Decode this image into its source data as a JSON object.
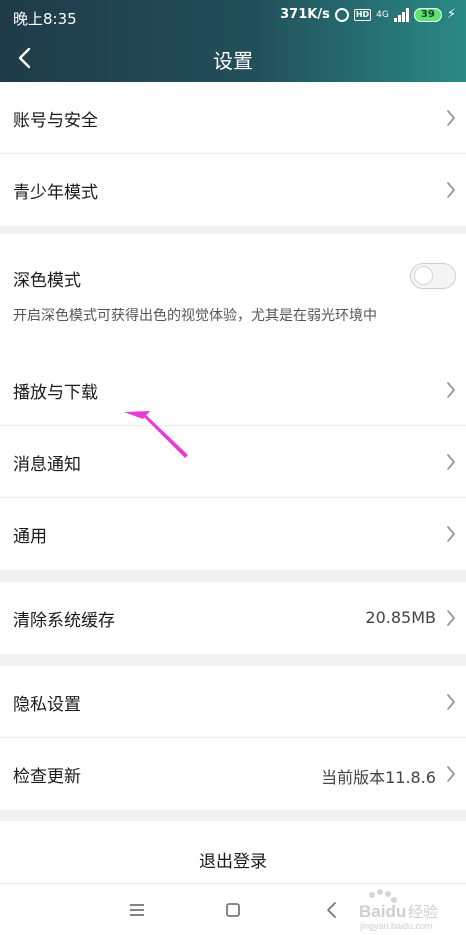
{
  "status_bar": {
    "time": "晚上8:35",
    "speed": "371K/s",
    "hd": "HD",
    "network": "4G",
    "battery": "39"
  },
  "header": {
    "title": "设置",
    "back_icon": "chevron-left-icon"
  },
  "groups": {
    "account": {
      "items": [
        {
          "label": "账号与安全"
        },
        {
          "label": "青少年模式"
        }
      ]
    },
    "dark_mode": {
      "label": "深色模式",
      "description": "开启深色模式可获得出色的视觉体验，尤其是在弱光环境中",
      "enabled": false
    },
    "playback": {
      "items": [
        {
          "label": "播放与下载"
        },
        {
          "label": "消息通知"
        },
        {
          "label": "通用"
        }
      ]
    },
    "cache": {
      "label": "清除系统缓存",
      "value": "20.85MB"
    },
    "privacy": {
      "items": [
        {
          "label": "隐私设置"
        },
        {
          "label": "检查更新",
          "value": "当前版本11.8.6"
        }
      ]
    }
  },
  "logout": {
    "label": "退出登录"
  },
  "system_nav": {
    "icons": [
      "menu-icon",
      "home-icon",
      "back-icon"
    ]
  },
  "colors": {
    "header_start": "#1f3b48",
    "header_end": "#2a8a86",
    "annotation": "#e83ad8"
  },
  "watermark": {
    "brand": "Baidu",
    "suffix": "经验",
    "url": "jingyan.baidu.com"
  }
}
